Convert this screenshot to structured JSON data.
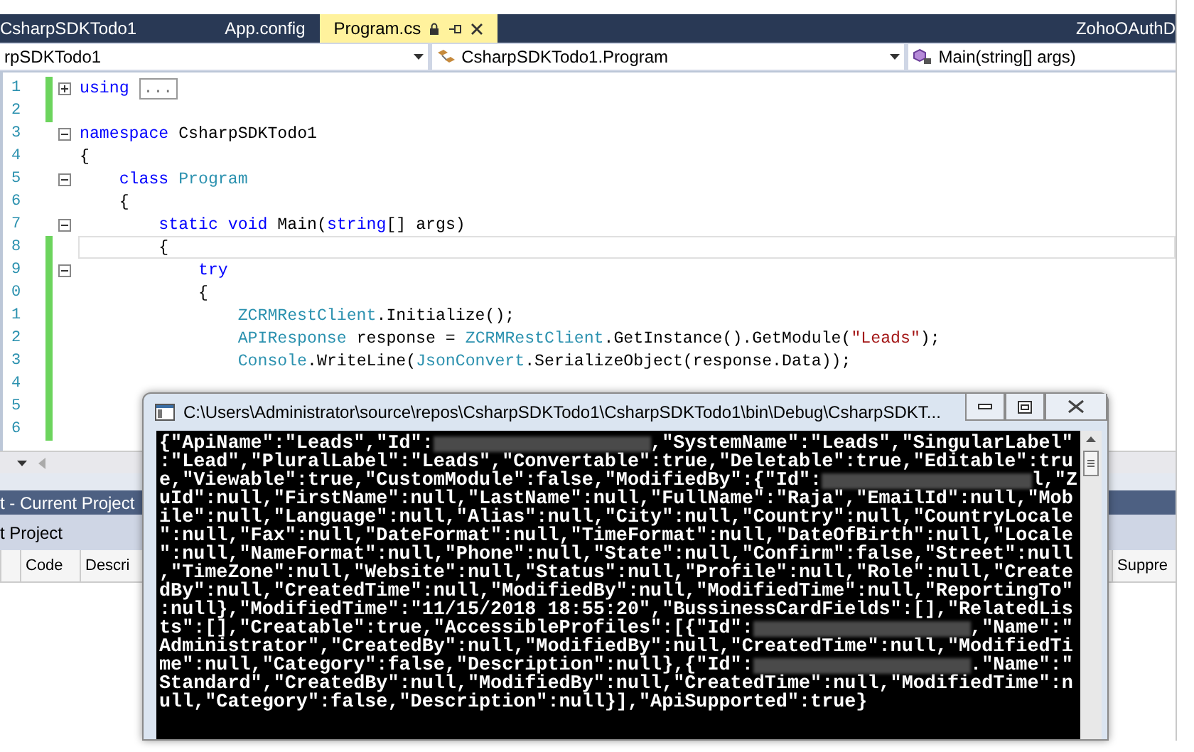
{
  "tabs": [
    {
      "label": "CsharpSDKTodo1",
      "selected": false
    },
    {
      "label": "App.config",
      "selected": false
    },
    {
      "label": "Program.cs",
      "selected": true
    }
  ],
  "tab_right": "ZohoOAuthD",
  "nav": {
    "project": "rpSDKTodo1",
    "class": "CsharpSDKTodo1.Program",
    "member": "Main(string[] args)"
  },
  "code_lines": [
    {
      "number": "1",
      "expanded": false,
      "changed": true,
      "current": false,
      "tokens": [
        {
          "kind": "kw",
          "text": "using "
        },
        {
          "kind": "collapsed",
          "text": "..."
        }
      ]
    },
    {
      "number": "2",
      "changed": true,
      "current": false
    },
    {
      "number": "3",
      "expanded": true,
      "changed": false,
      "current": false,
      "tokens": [
        {
          "kind": "kw",
          "text": "namespace"
        },
        {
          "kind": "plain",
          "text": " CsharpSDKTodo1"
        }
      ]
    },
    {
      "number": "4",
      "changed": false,
      "current": false,
      "tokens": [
        {
          "kind": "plain",
          "text": "{"
        }
      ]
    },
    {
      "number": "5",
      "expanded": true,
      "changed": false,
      "current": false,
      "tokens": [
        {
          "kind": "kw",
          "text": "    class"
        },
        {
          "kind": "type",
          "text": " Program"
        }
      ]
    },
    {
      "number": "6",
      "changed": false,
      "current": false,
      "tokens": [
        {
          "kind": "plain",
          "text": "    {"
        }
      ]
    },
    {
      "number": "7",
      "expanded": true,
      "changed": false,
      "current": false,
      "tokens": [
        {
          "kind": "kw",
          "text": "        static void"
        },
        {
          "kind": "plain",
          "text": " Main("
        },
        {
          "kind": "kw",
          "text": "string"
        },
        {
          "kind": "plain",
          "text": "[] args)"
        }
      ]
    },
    {
      "number": "8",
      "changed": true,
      "current": true,
      "tokens": [
        {
          "kind": "plain",
          "text": "        {"
        }
      ]
    },
    {
      "number": "9",
      "expanded": true,
      "changed": true,
      "current": false,
      "tokens": [
        {
          "kind": "kw",
          "text": "            try"
        }
      ]
    },
    {
      "number": "0",
      "changed": true,
      "current": false,
      "tokens": [
        {
          "kind": "plain",
          "text": "            {"
        }
      ]
    },
    {
      "number": "1",
      "changed": true,
      "current": false,
      "tokens": [
        {
          "kind": "type",
          "text": "                ZCRMRestClient"
        },
        {
          "kind": "plain",
          "text": ".Initialize();"
        }
      ]
    },
    {
      "number": "2",
      "changed": true,
      "current": false,
      "tokens": [
        {
          "kind": "type",
          "text": "                APIResponse"
        },
        {
          "kind": "plain",
          "text": " response = "
        },
        {
          "kind": "type",
          "text": "ZCRMRestClient"
        },
        {
          "kind": "plain",
          "text": ".GetInstance().GetModule("
        },
        {
          "kind": "str",
          "text": "\"Leads\""
        },
        {
          "kind": "plain",
          "text": ");"
        }
      ]
    },
    {
      "number": "3",
      "changed": true,
      "current": false,
      "tokens": [
        {
          "kind": "type",
          "text": "                Console"
        },
        {
          "kind": "plain",
          "text": ".WriteLine("
        },
        {
          "kind": "type",
          "text": "JsonConvert"
        },
        {
          "kind": "plain",
          "text": ".SerializeObject(response.Data));"
        }
      ]
    },
    {
      "number": "4",
      "changed": true,
      "current": false
    },
    {
      "number": "5",
      "changed": true,
      "current": false
    },
    {
      "number": "6",
      "changed": true,
      "current": false
    }
  ],
  "error_list": {
    "title": "t - Current Project",
    "scope": "t Project",
    "columns": [
      "Code",
      "Descri",
      "Suppre"
    ]
  },
  "console": {
    "title": "C:\\Users\\Administrator\\source\\repos\\CsharpSDKTodo1\\CsharpSDKTodo1\\bin\\Debug\\CsharpSDKT...",
    "lines": [
      [
        {
          "kind": "text",
          "text": "{\"ApiName\":\"Leads\",\"Id\":"
        },
        {
          "kind": "redacted"
        },
        {
          "kind": "text",
          "text": ",\"SystemName\":\"Leads\",\"SingularLabel\""
        }
      ],
      [
        {
          "kind": "text",
          "text": ":\"Lead\",\"PluralLabel\":\"Leads\",\"Convertable\":true,\"Deletable\":true,\"Editable\":tru"
        }
      ],
      [
        {
          "kind": "text",
          "text": "e,\"Viewable\":true,\"CustomModule\":false,\"ModifiedBy\":{\"Id\":"
        },
        {
          "kind": "redacted"
        },
        {
          "kind": "text",
          "text": "l,\"Z"
        }
      ],
      [
        {
          "kind": "text",
          "text": "uId\":null,\"FirstName\":null,\"LastName\":null,\"FullName\":\"Raja\",\"EmailId\":null,\"Mob"
        }
      ],
      [
        {
          "kind": "text",
          "text": "ile\":null,\"Language\":null,\"Alias\":null,\"City\":null,\"Country\":null,\"CountryLocale"
        }
      ],
      [
        {
          "kind": "text",
          "text": "\":null,\"Fax\":null,\"DateFormat\":null,\"TimeFormat\":null,\"DateOfBirth\":null,\"Locale"
        }
      ],
      [
        {
          "kind": "text",
          "text": "\":null,\"NameFormat\":null,\"Phone\":null,\"State\":null,\"Confirm\":false,\"Street\":null"
        }
      ],
      [
        {
          "kind": "text",
          "text": ",\"TimeZone\":null,\"Website\":null,\"Status\":null,\"Profile\":null,\"Role\":null,\"Create"
        }
      ],
      [
        {
          "kind": "text",
          "text": "dBy\":null,\"CreatedTime\":null,\"ModifiedBy\":null,\"ModifiedTime\":null,\"ReportingTo\""
        }
      ],
      [
        {
          "kind": "text",
          "text": ":null},\"ModifiedTime\":\"11/15/2018 18:55:20\",\"BussinessCardFields\":[],\"RelatedLis"
        }
      ],
      [
        {
          "kind": "text",
          "text": "ts\":[],\"Creatable\":true,\"AccessibleProfiles\":[{\"Id\":"
        },
        {
          "kind": "redacted"
        },
        {
          "kind": "text",
          "text": ",\"Name\":\""
        }
      ],
      [
        {
          "kind": "text",
          "text": "Administrator\",\"CreatedBy\":null,\"ModifiedBy\":null,\"CreatedTime\":null,\"ModifiedTi"
        }
      ],
      [
        {
          "kind": "text",
          "text": "me\":null,\"Category\":false,\"Description\":null},{\"Id\":"
        },
        {
          "kind": "redacted"
        },
        {
          "kind": "text",
          "text": ".\"Name\":\""
        }
      ],
      [
        {
          "kind": "text",
          "text": "Standard\",\"CreatedBy\":null,\"ModifiedBy\":null,\"CreatedTime\":null,\"ModifiedTime\":n"
        }
      ],
      [
        {
          "kind": "text",
          "text": "ull,\"Category\":false,\"Description\":null}],\"ApiSupported\":true}"
        }
      ]
    ]
  }
}
